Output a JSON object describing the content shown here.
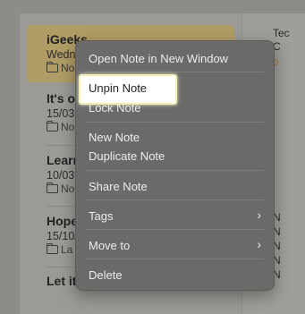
{
  "notes": [
    {
      "title": "iGeeks",
      "date": "Wedn",
      "folder": "No"
    },
    {
      "title": "It's o",
      "date": "15/03",
      "folder": "No"
    },
    {
      "title": "Learr",
      "date": "10/03",
      "folder": "No"
    },
    {
      "title": "Hope",
      "date": "15/10/",
      "folder": "La"
    },
    {
      "title": "Let it",
      "date": "",
      "folder": ""
    }
  ],
  "preview": {
    "lines": [
      "Tec",
      "C",
      "p",
      "N",
      "N",
      "N",
      "N",
      "N"
    ]
  },
  "context_menu": {
    "open_new_window": "Open Note in New Window",
    "unpin": "Unpin Note",
    "lock": "Lock Note",
    "new_note": "New Note",
    "duplicate": "Duplicate Note",
    "share": "Share Note",
    "tags": "Tags",
    "move_to": "Move to",
    "delete": "Delete",
    "chevron": "›"
  },
  "colors": {
    "selection": "#b09d66",
    "menu_bg": "#6b6a68",
    "highlight_border": "#f4f0b8"
  }
}
